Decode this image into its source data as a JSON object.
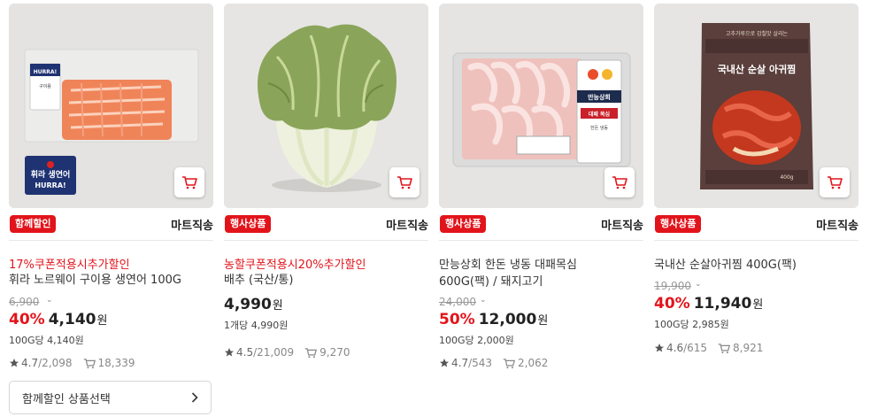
{
  "products": [
    {
      "badge": "함께할인",
      "channel": "마트직송",
      "promo": "17%쿠폰적용시추가할인",
      "name": "휘라 노르웨이 구이용 생연어 100G",
      "original_price": "6,900",
      "discount_rate": "40%",
      "price": "4,140",
      "currency": "원",
      "unit_price": "100G당 4,140원",
      "rating": "4.7",
      "review_count": "/2,098",
      "cart_count": "18,339",
      "package_text": {
        "brand": "HURRA!",
        "title": "휘라 생연어",
        "sub": "구이용"
      },
      "select_button": "함께할인 상품선택"
    },
    {
      "badge": "행사상품",
      "channel": "마트직송",
      "promo": "농할쿠폰적용시20%추가할인",
      "name": "배추 (국산/통)",
      "price": "4,990",
      "currency": "원",
      "unit_price": "1개당 4,990원",
      "rating": "4.5",
      "review_count": "/21,009",
      "cart_count": "9,270"
    },
    {
      "badge": "행사상품",
      "channel": "마트직송",
      "name": "만능상회 한돈 냉동 대패목심 600G(팩) / 돼지고기",
      "original_price": "24,000",
      "discount_rate": "50%",
      "price": "12,000",
      "currency": "원",
      "unit_price": "100G당 2,000원",
      "rating": "4.7",
      "review_count": "/543",
      "cart_count": "2,062",
      "package_text": {
        "brand": "만능상회",
        "title": "대패 목심",
        "sub": "한돈 냉동"
      }
    },
    {
      "badge": "행사상품",
      "channel": "마트직송",
      "name": "국내산 순살아귀찜 400G(팩)",
      "original_price": "19,900",
      "discount_rate": "40%",
      "price": "11,940",
      "currency": "원",
      "unit_price": "100G당 2,985원",
      "rating": "4.6",
      "review_count": "/615",
      "cart_count": "8,921",
      "package_text": {
        "title": "국내산 순살 아귀찜",
        "sub": "고추가루으로 감칠맛 살리는",
        "weight": "400g"
      }
    }
  ],
  "icons": {
    "cart": "cart-icon",
    "star": "star-icon",
    "cart_count": "cart-check-icon",
    "chevron": "chevron-down-icon",
    "arrow": "chevron-right-icon"
  },
  "colors": {
    "accent": "#e2141b",
    "text": "#222222",
    "muted": "#999999"
  }
}
